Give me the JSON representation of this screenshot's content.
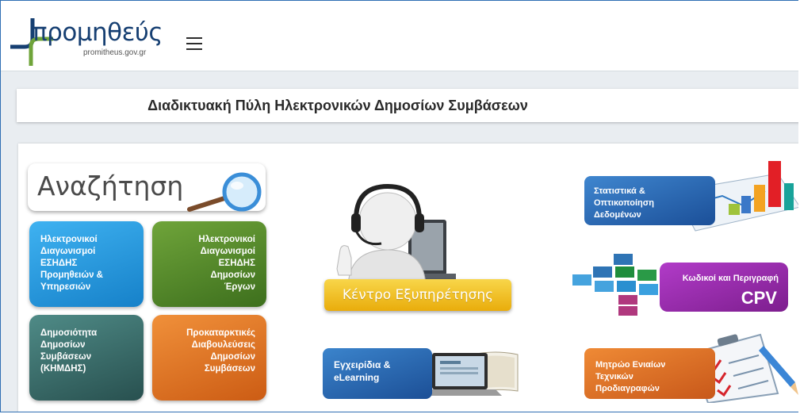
{
  "header": {
    "logo_text": "πρoμηθεύς",
    "logo_subtitle": "promitheus.gov.gr"
  },
  "portal_title": "Διαδικτυακή Πύλη Ηλεκτρονικών Δημοσίων Συμβάσεων",
  "search": {
    "label": "Αναζήτηση"
  },
  "tiles": {
    "supplies": [
      "Ηλεκτρονικοί",
      "Διαγωνισμοί",
      "ΕΣΗΔΗΣ",
      "Προμηθειών &",
      "Υπηρεσιών"
    ],
    "works": [
      "Ηλεκτρονικοί",
      "Διαγωνισμοί",
      "ΕΣΗΔΗΣ",
      "Δημοσίων",
      "Έργων"
    ],
    "publicity": [
      "Δημοσιότητα",
      "Δημοσίων",
      "Συμβάσεων",
      "(ΚΗΜΔΗΣ)"
    ],
    "consultations": [
      "Προκαταρκτικές",
      "Διαβουλεύσεις",
      "Δημοσίων",
      "Συμβάσεων"
    ]
  },
  "helpdesk": {
    "label": "Κέντρο Εξυπηρέτησης"
  },
  "manuals": {
    "line1": "Εγχειρίδια &",
    "line2": "eLearning"
  },
  "stats": {
    "line1": "Στατιστικά &",
    "line2": "Οπτικοποίηση",
    "line3": "Δεδομένων"
  },
  "cpv": {
    "title": "Κωδικοί και Περιγραφή",
    "code": "CPV"
  },
  "registry": {
    "line1": "Μητρώο Ενιαίων",
    "line2": "Τεχνικών",
    "line3": "Προδιαγραφών"
  },
  "colors": {
    "brand_blue": "#163f72",
    "brand_green": "#6fa43a",
    "tile_blue": "#1681c9",
    "tile_green": "#3d6f1d",
    "tile_teal": "#28504f",
    "tile_orange": "#cc5c14",
    "helpdesk_yellow": "#e9ac0b",
    "cpv_purple": "#7d1e8e"
  }
}
